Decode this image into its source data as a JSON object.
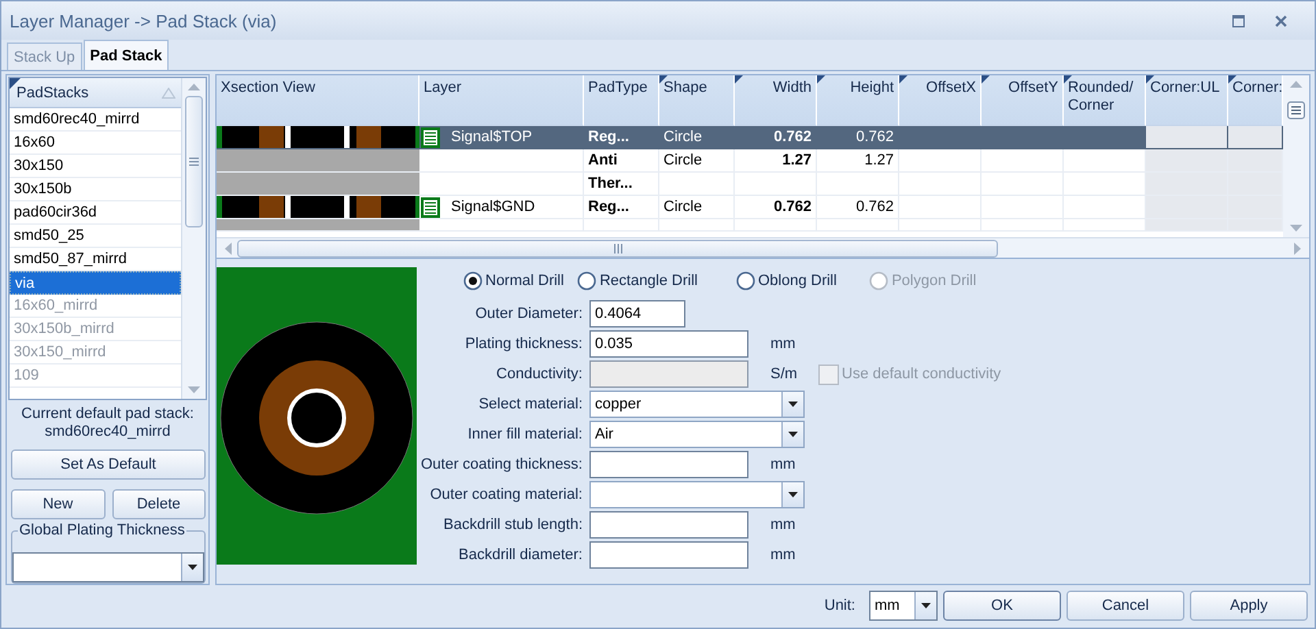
{
  "window": {
    "title": "Layer Manager -> Pad Stack (via)"
  },
  "tabs": [
    {
      "label": "Stack Up",
      "selected": false
    },
    {
      "label": "Pad Stack",
      "selected": true
    }
  ],
  "padstacks": {
    "header": "PadStacks",
    "items": [
      {
        "label": "smd60rec40_mirrd",
        "selected": false,
        "dimmed": false
      },
      {
        "label": "16x60",
        "selected": false,
        "dimmed": false
      },
      {
        "label": "30x150",
        "selected": false,
        "dimmed": false
      },
      {
        "label": "30x150b",
        "selected": false,
        "dimmed": false
      },
      {
        "label": "pad60cir36d",
        "selected": false,
        "dimmed": false
      },
      {
        "label": "smd50_25",
        "selected": false,
        "dimmed": false
      },
      {
        "label": "smd50_87_mirrd",
        "selected": false,
        "dimmed": false
      },
      {
        "label": "via",
        "selected": true,
        "dimmed": false
      },
      {
        "label": "16x60_mirrd",
        "selected": false,
        "dimmed": true
      },
      {
        "label": "30x150b_mirrd",
        "selected": false,
        "dimmed": true
      },
      {
        "label": "30x150_mirrd",
        "selected": false,
        "dimmed": true
      },
      {
        "label": "109",
        "selected": false,
        "dimmed": true
      }
    ]
  },
  "default_pad_stack": {
    "caption": "Current default pad stack:",
    "value": "smd60rec40_mirrd"
  },
  "set_default_button": "Set As Default",
  "new_button": "New",
  "delete_button": "Delete",
  "global_plating": {
    "legend": "Global Plating Thickness"
  },
  "grid": {
    "columns": [
      "Xsection View",
      "Layer",
      "PadType",
      "Shape",
      "Width",
      "Height",
      "OffsetX",
      "OffsetY",
      "Rounded/ Corner",
      "Corner:UL",
      "Corner:"
    ],
    "rows": [
      {
        "kind": "layer",
        "cells": [
          "",
          "Signal$TOP",
          "Reg...",
          "Circle",
          "0.762",
          "0.762"
        ],
        "selected": true
      },
      {
        "kind": "blank",
        "cells": [
          "",
          "",
          "Anti",
          "Circle",
          "1.27",
          "1.27"
        ],
        "selected": false
      },
      {
        "kind": "blank",
        "cells": [
          "",
          "",
          "Ther..."
        ],
        "selected": false
      },
      {
        "kind": "layer",
        "cells": [
          "",
          "Signal$GND",
          "Reg...",
          "Circle",
          "0.762",
          "0.762"
        ],
        "selected": false
      },
      {
        "kind": "blank",
        "cells": [],
        "selected": false
      }
    ]
  },
  "drill_types": [
    {
      "label": "Normal Drill",
      "selected": true,
      "disabled": false
    },
    {
      "label": "Rectangle Drill",
      "selected": false,
      "disabled": false
    },
    {
      "label": "Oblong Drill",
      "selected": false,
      "disabled": false
    },
    {
      "label": "Polygon Drill",
      "selected": false,
      "disabled": true
    }
  ],
  "fields": [
    {
      "kind": "short",
      "label": "Outer Diameter:",
      "value": "0.4064",
      "disabled": false
    },
    {
      "kind": "text",
      "label": "Plating thickness:",
      "value": "0.035",
      "unit": "mm",
      "disabled": false
    },
    {
      "kind": "text",
      "label": "Conductivity:",
      "unit": "S/m",
      "disabled": true,
      "checkbox": {
        "label": "Use default conductivity",
        "checked": false,
        "disabled": true
      }
    },
    {
      "kind": "combo",
      "label": "Select material:",
      "value": "copper",
      "disabled": false
    },
    {
      "kind": "combo",
      "label": "Inner fill material:",
      "value": "Air",
      "disabled": false
    },
    {
      "kind": "text",
      "label": "Outer coating thickness:",
      "unit": "mm",
      "disabled": false
    },
    {
      "kind": "combo",
      "label": "Outer coating material:",
      "disabled": false
    },
    {
      "kind": "text",
      "label": "Backdrill stub length:",
      "unit": "mm",
      "disabled": false
    },
    {
      "kind": "text",
      "label": "Backdrill diameter:",
      "unit": "mm",
      "disabled": false
    }
  ],
  "footer": {
    "unit_label": "Unit:",
    "unit_value": "mm",
    "buttons": [
      "OK",
      "Cancel",
      "Apply"
    ]
  }
}
